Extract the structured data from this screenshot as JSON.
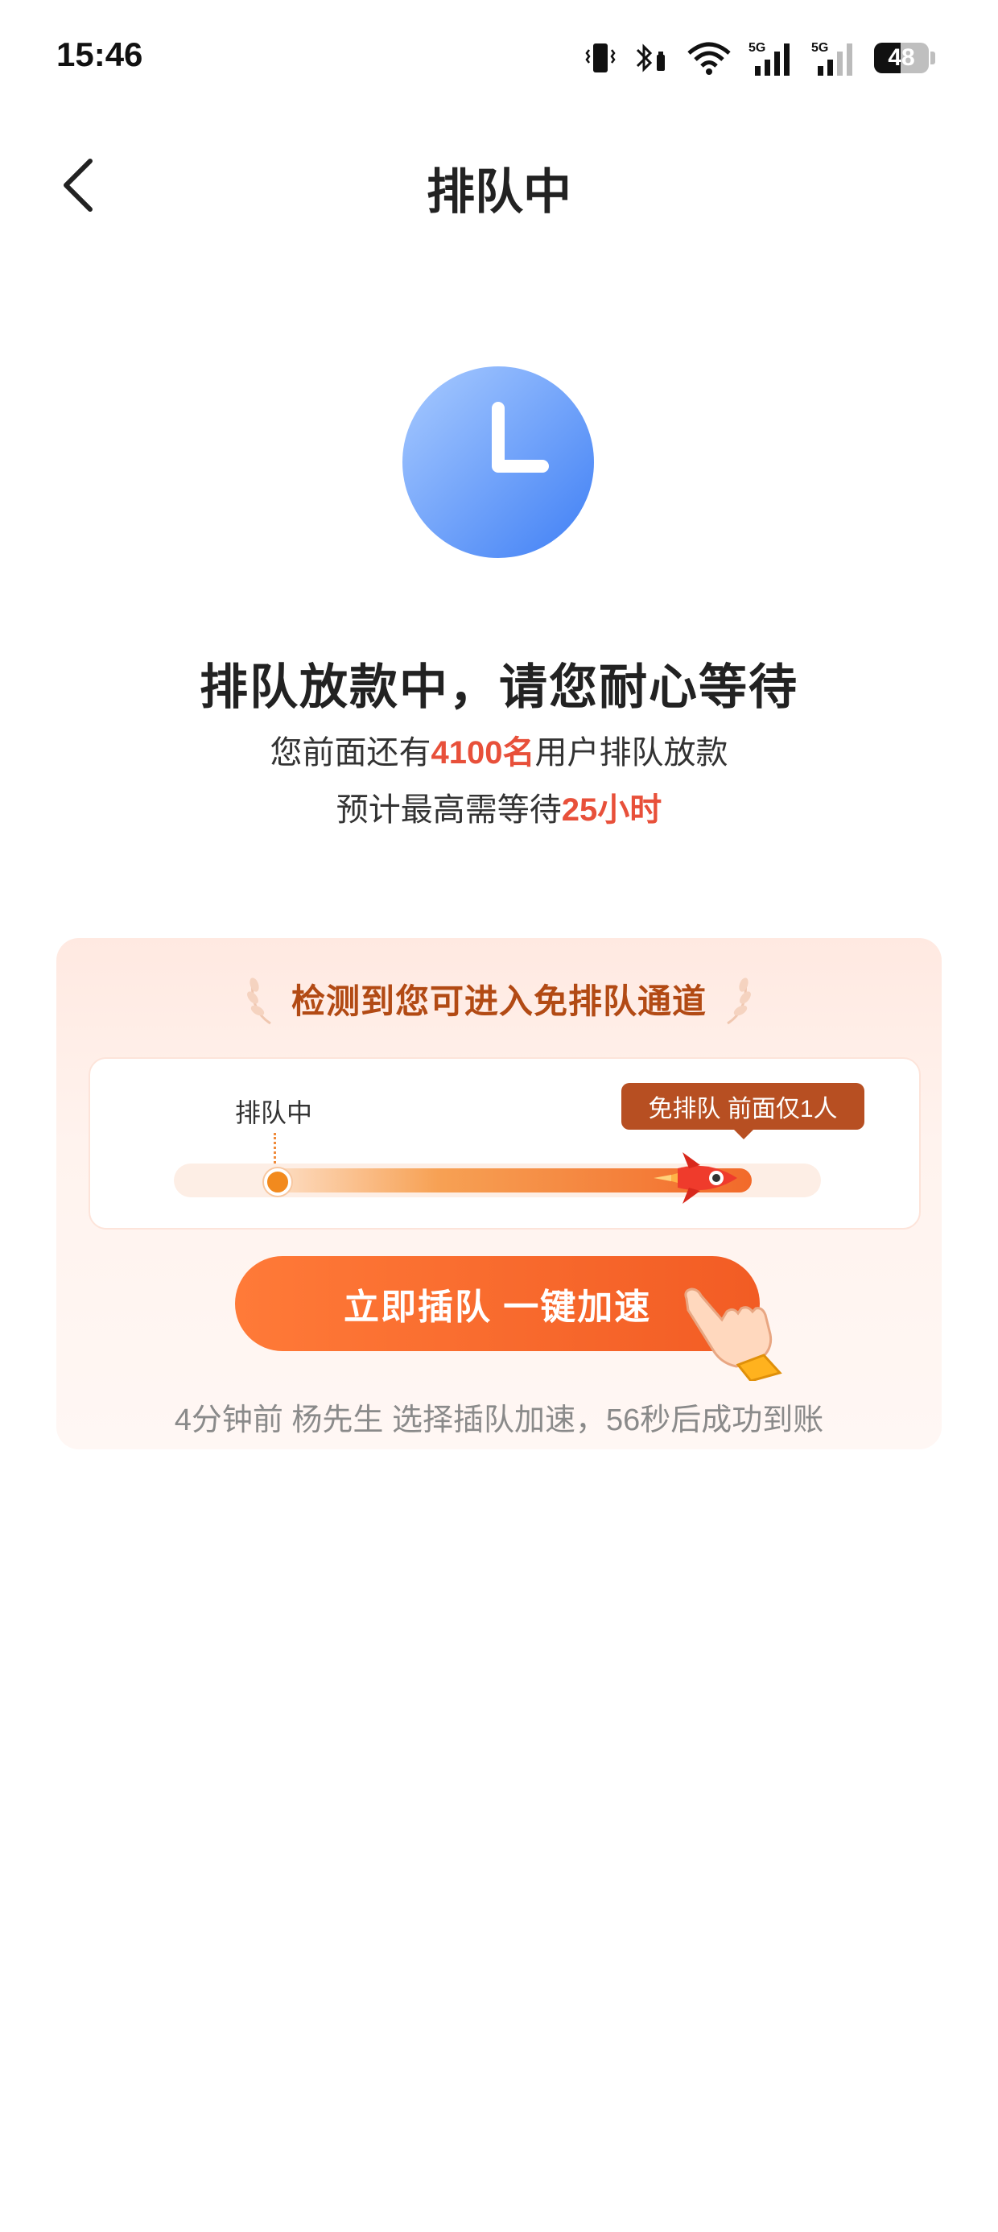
{
  "status_bar": {
    "time": "15:46",
    "battery_level": "48",
    "battery_fraction": 0.48,
    "network_labels": [
      "5G",
      "5G"
    ]
  },
  "nav": {
    "title": "排队中"
  },
  "status": {
    "headline": "排队放款中，请您耐心等待",
    "queue_prefix": "您前面还有",
    "queue_count": "4100名",
    "queue_suffix": "用户排队放款",
    "wait_prefix": "预计最高需等待",
    "wait_time": "25小时"
  },
  "promo": {
    "title": "检测到您可进入免排队通道",
    "queue_label": "排队中",
    "skip_badge": "免排队  前面仅1人",
    "cta_label": "立即插队  一键加速",
    "ticker": "4分钟前 杨先生 选择插队加速，56秒后成功到账"
  },
  "colors": {
    "accent_blue": "#4d8ef7",
    "highlight_red": "#e8503a",
    "cta_orange": "#f25c24",
    "badge_brown": "#b74f22"
  },
  "icons": [
    "back-arrow",
    "clock",
    "vibrate",
    "bluetooth",
    "wifi",
    "signal",
    "battery",
    "laurel",
    "rocket",
    "pointing-hand"
  ]
}
